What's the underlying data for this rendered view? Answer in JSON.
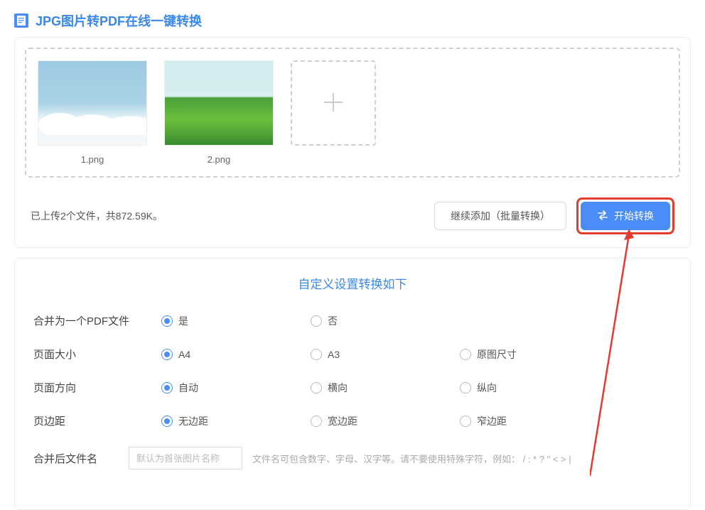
{
  "header": {
    "title": "JPG图片转PDF在线一键转换"
  },
  "upload": {
    "files": [
      {
        "name": "1.png"
      },
      {
        "name": "2.png"
      }
    ],
    "status": "已上传2个文件，共872.59K。",
    "continueAdd": "继续添加（批量转换）",
    "startConvert": "开始转换"
  },
  "settings": {
    "title": "自定义设置转换如下",
    "merge": {
      "label": "合并为一个PDF文件",
      "yes": "是",
      "no": "否",
      "selected": "yes"
    },
    "pageSize": {
      "label": "页面大小",
      "a4": "A4",
      "a3": "A3",
      "original": "原图尺寸",
      "selected": "a4"
    },
    "orientation": {
      "label": "页面方向",
      "auto": "自动",
      "landscape": "横向",
      "portrait": "纵向",
      "selected": "auto"
    },
    "margin": {
      "label": "页边距",
      "none": "无边距",
      "wide": "宽边距",
      "narrow": "窄边距",
      "selected": "none"
    },
    "filename": {
      "label": "合并后文件名",
      "placeholder": "默认为首张图片名称",
      "hint": "文件名可包含数字、字母、汉字等。请不要使用特殊字符，例如： / : * ? \" < > |"
    }
  }
}
